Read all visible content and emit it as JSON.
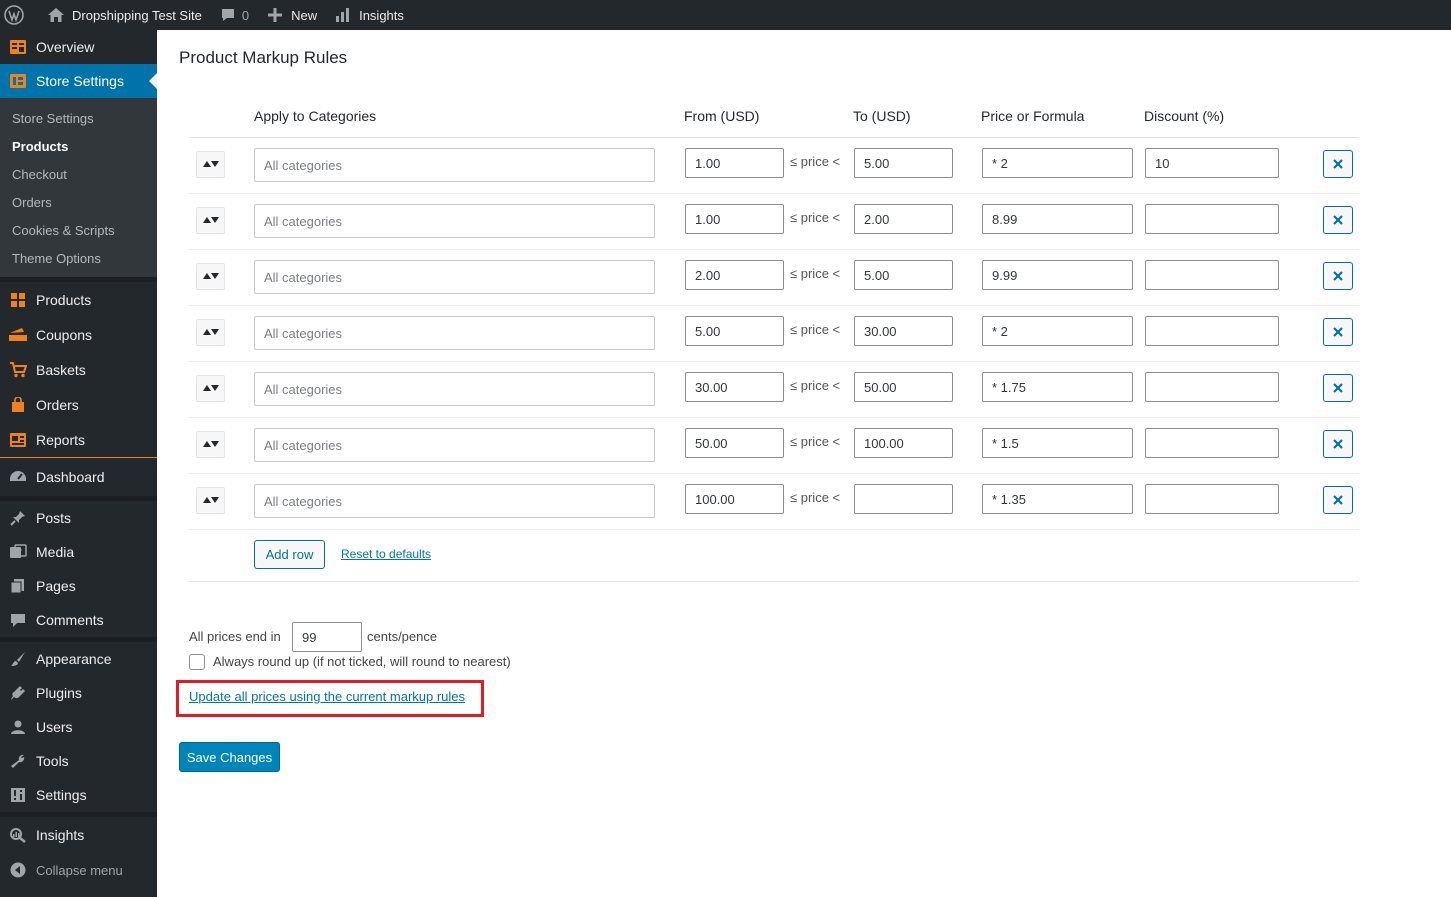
{
  "adminbar": {
    "site_name": "Dropshipping Test Site",
    "comments_count": "0",
    "new_label": "New",
    "insights_label": "Insights"
  },
  "sidebar": {
    "overview": "Overview",
    "store_settings": "Store Settings",
    "submenu": [
      "Store Settings",
      "Products",
      "Checkout",
      "Orders",
      "Cookies & Scripts",
      "Theme Options"
    ],
    "active_sub": "Products",
    "store_items": [
      "Products",
      "Coupons",
      "Baskets",
      "Orders",
      "Reports"
    ],
    "dashboard": "Dashboard",
    "content_items": [
      "Posts",
      "Media",
      "Pages",
      "Comments"
    ],
    "admin_items": [
      "Appearance",
      "Plugins",
      "Users",
      "Tools",
      "Settings"
    ],
    "insights": "Insights",
    "collapse": "Collapse menu"
  },
  "page": {
    "title": "Product Markup Rules"
  },
  "table": {
    "headers": {
      "categories": "Apply to Categories",
      "from": "From (USD)",
      "to": "To (USD)",
      "formula": "Price or Formula",
      "discount": "Discount (%)"
    },
    "category_placeholder": "All categories",
    "price_label": "≤ price <",
    "rows": [
      {
        "from": "1.00",
        "to": "5.00",
        "formula": "* 2",
        "discount": "10"
      },
      {
        "from": "1.00",
        "to": "2.00",
        "formula": "8.99",
        "discount": ""
      },
      {
        "from": "2.00",
        "to": "5.00",
        "formula": "9.99",
        "discount": ""
      },
      {
        "from": "5.00",
        "to": "30.00",
        "formula": "* 2",
        "discount": ""
      },
      {
        "from": "30.00",
        "to": "50.00",
        "formula": "* 1.75",
        "discount": ""
      },
      {
        "from": "50.00",
        "to": "100.00",
        "formula": "* 1.5",
        "discount": ""
      },
      {
        "from": "100.00",
        "to": "",
        "formula": "* 1.35",
        "discount": ""
      }
    ],
    "add_row": "Add row",
    "reset_defaults": "Reset to defaults"
  },
  "settings": {
    "prices_end_label": "All prices end in",
    "cents_value": "99",
    "cents_unit": "cents/pence",
    "round_up_label": "Always round up (if not ticked, will round to nearest)",
    "round_up_checked": false,
    "update_link": "Update all prices using the current markup rules",
    "save_button": "Save Changes"
  },
  "colors": {
    "accent": "#0073aa",
    "store_icon": "#f0821e",
    "highlight": "#e31b23",
    "sidebar_bg": "#23282d"
  }
}
